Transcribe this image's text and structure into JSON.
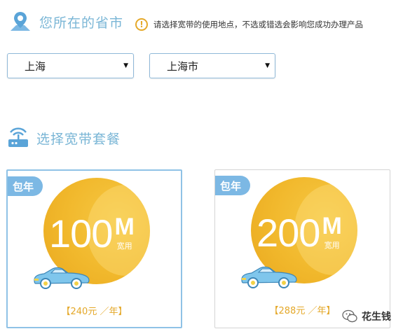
{
  "province_section": {
    "title": "您所在的省市",
    "notice": "请选择宽带的使用地点，不选或错选会影响您成功办理产品",
    "province_value": "上海",
    "city_value": "上海市"
  },
  "package_section": {
    "title": "选择宽带套餐"
  },
  "packages": [
    {
      "badge": "包年",
      "speed": "100",
      "unit": "M",
      "unit_label": "宽用",
      "price": "【240元 ／年】"
    },
    {
      "badge": "包年",
      "speed": "200",
      "unit": "M",
      "unit_label": "宽用",
      "price": "【288元 ／年】"
    }
  ],
  "watermark": {
    "text": "花生钱"
  },
  "colors": {
    "accent_blue": "#7ab6d6",
    "badge_blue": "#7cb8e4",
    "circle_gold": "#f1b82c",
    "price_gold": "#e4a829"
  },
  "icons": [
    "location-pin-icon",
    "warning-circle-icon",
    "chevron-down-icon",
    "router-icon",
    "car-icon",
    "wechat-icon"
  ]
}
